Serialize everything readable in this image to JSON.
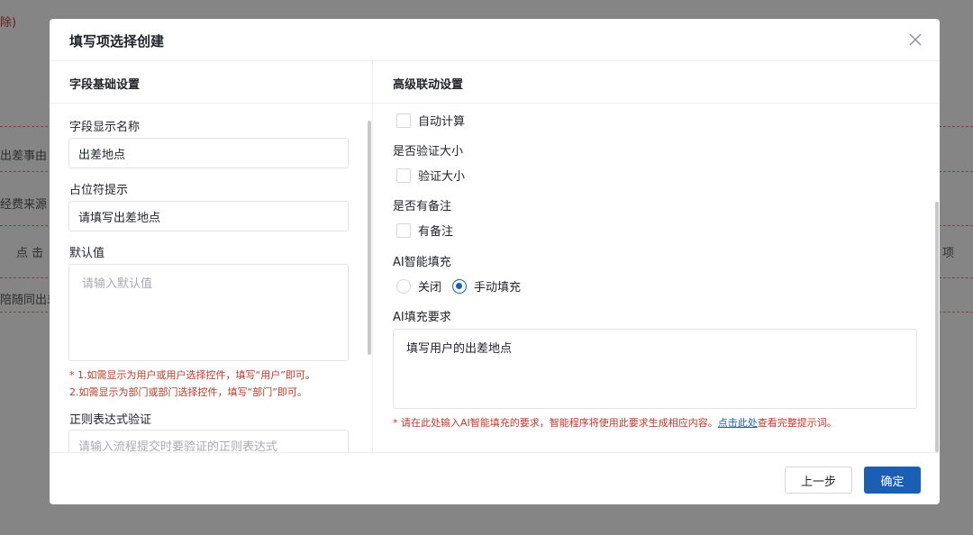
{
  "background": {
    "corner_text": "除)",
    "rows": [
      "出差事由",
      "经费来源",
      "点 击",
      "陪随同出差"
    ],
    "right_fragment": "项"
  },
  "modal": {
    "title": "填写项选择创建",
    "close_icon": "close-icon"
  },
  "left": {
    "section_title": "字段基础设置",
    "display_name_label": "字段显示名称",
    "display_name_value": "出差地点",
    "placeholder_label": "占位符提示",
    "placeholder_value": "请填写出差地点",
    "default_label": "默认值",
    "default_placeholder": "请输入默认值",
    "hint_line1": "* 1.如需显示为用户或用户选择控件，填写“用户”即可。",
    "hint_line2": "2.如需显示为部门或部门选择控件，填写“部门”即可。",
    "regex_label": "正则表达式验证",
    "regex_placeholder": "请输入流程提交时要验证的正则表达式"
  },
  "right": {
    "section_title": "高级联动设置",
    "auto_calc_label": "自动计算",
    "verify_size_title": "是否验证大小",
    "verify_size_label": "验证大小",
    "remark_title": "是否有备注",
    "remark_label": "有备注",
    "ai_fill_title": "AI智能填充",
    "ai_fill_options": [
      {
        "label": "关闭",
        "checked": false
      },
      {
        "label": "手动填充",
        "checked": true
      }
    ],
    "ai_requirement_title": "AI填充要求",
    "ai_requirement_value": "填写用户的出差地点",
    "hint_prefix": "* 请在此处输入AI智能填充的要求，智能程序将使用此要求生成相应内容。",
    "hint_link": "点击此处",
    "hint_suffix": "查看完整提示词。"
  },
  "footer": {
    "prev_label": "上一步",
    "ok_label": "确定"
  },
  "colors": {
    "primary": "#1a5fb4",
    "hint": "#c0392b"
  }
}
